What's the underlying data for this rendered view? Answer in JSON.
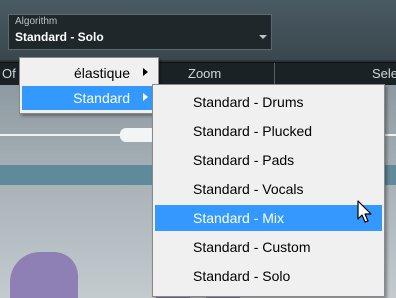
{
  "algorithm": {
    "label": "Algorithm",
    "value": "Standard - Solo"
  },
  "background_header": {
    "left_text": "Of",
    "zoom_label": "Zoom",
    "right_text": "Sele"
  },
  "menu": {
    "items": [
      {
        "label": "élastique",
        "has_submenu": true,
        "selected": false
      },
      {
        "label": "Standard",
        "has_submenu": true,
        "selected": true
      }
    ]
  },
  "submenu": {
    "items": [
      {
        "label": "Standard - Drums"
      },
      {
        "label": "Standard - Plucked"
      },
      {
        "label": "Standard - Pads"
      },
      {
        "label": "Standard - Vocals"
      },
      {
        "label": "Standard - Mix",
        "highlighted": true
      },
      {
        "label": "Standard - Custom"
      },
      {
        "label": "Standard - Solo"
      }
    ]
  },
  "colors": {
    "highlight": "#3399ff",
    "menu_bg": "#f0f0f0"
  }
}
